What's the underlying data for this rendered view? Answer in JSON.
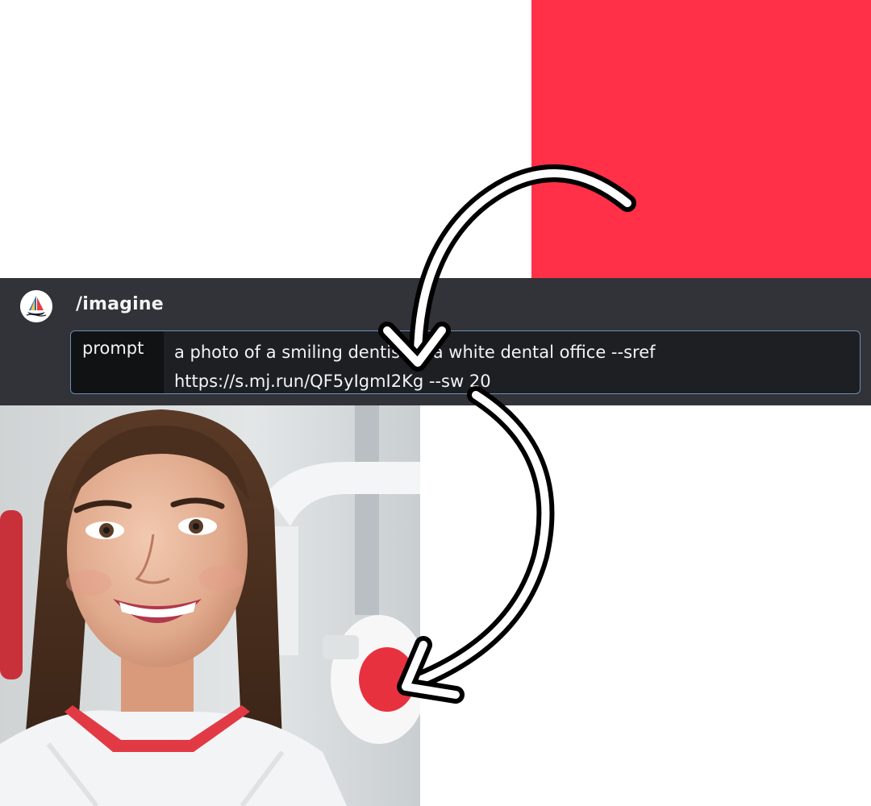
{
  "style_reference": {
    "color": "#ff3048"
  },
  "command": {
    "bot_icon": "midjourney-sailboat-icon",
    "name": "/imagine",
    "prompt_label": "prompt",
    "prompt_line_1": "a photo of a smiling dentist in a white dental office --sref",
    "prompt_line_2": "https://s.mj.run/QF5yIgmI2Kg --sw 20"
  },
  "result_image": {
    "icon": "generated-photo-image"
  },
  "annotations": {
    "icon": "curved-arrow-icon"
  },
  "colors": {
    "panel_bg": "#313338",
    "input_bg": "#1e1f22",
    "label_bg": "#111214",
    "input_border": "#6e8fb7",
    "text": "#f2f3f5",
    "accent_red": "#ff3048"
  }
}
